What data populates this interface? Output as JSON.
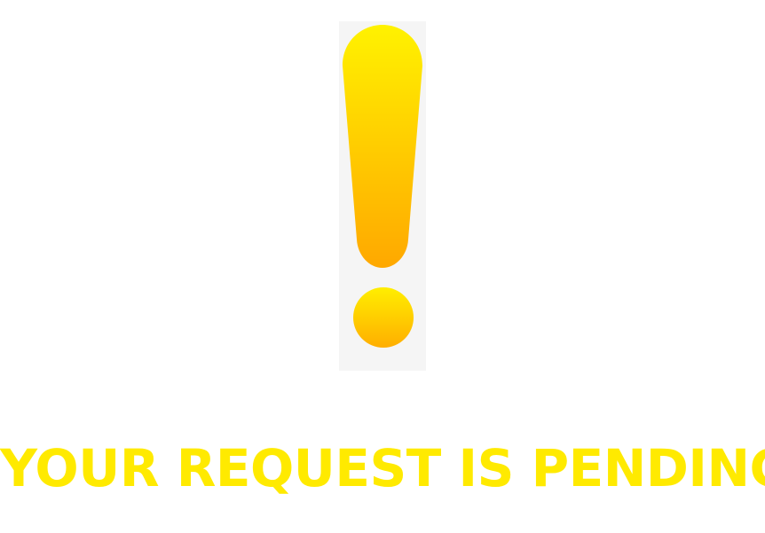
{
  "status": {
    "icon": "exclamation-icon",
    "message": "YOUR REQUEST IS PENDING"
  },
  "colors": {
    "message": "#ffea00",
    "icon_gradient_top": "#fff200",
    "icon_gradient_bottom": "#ffa800",
    "icon_background": "#f5f5f5"
  }
}
